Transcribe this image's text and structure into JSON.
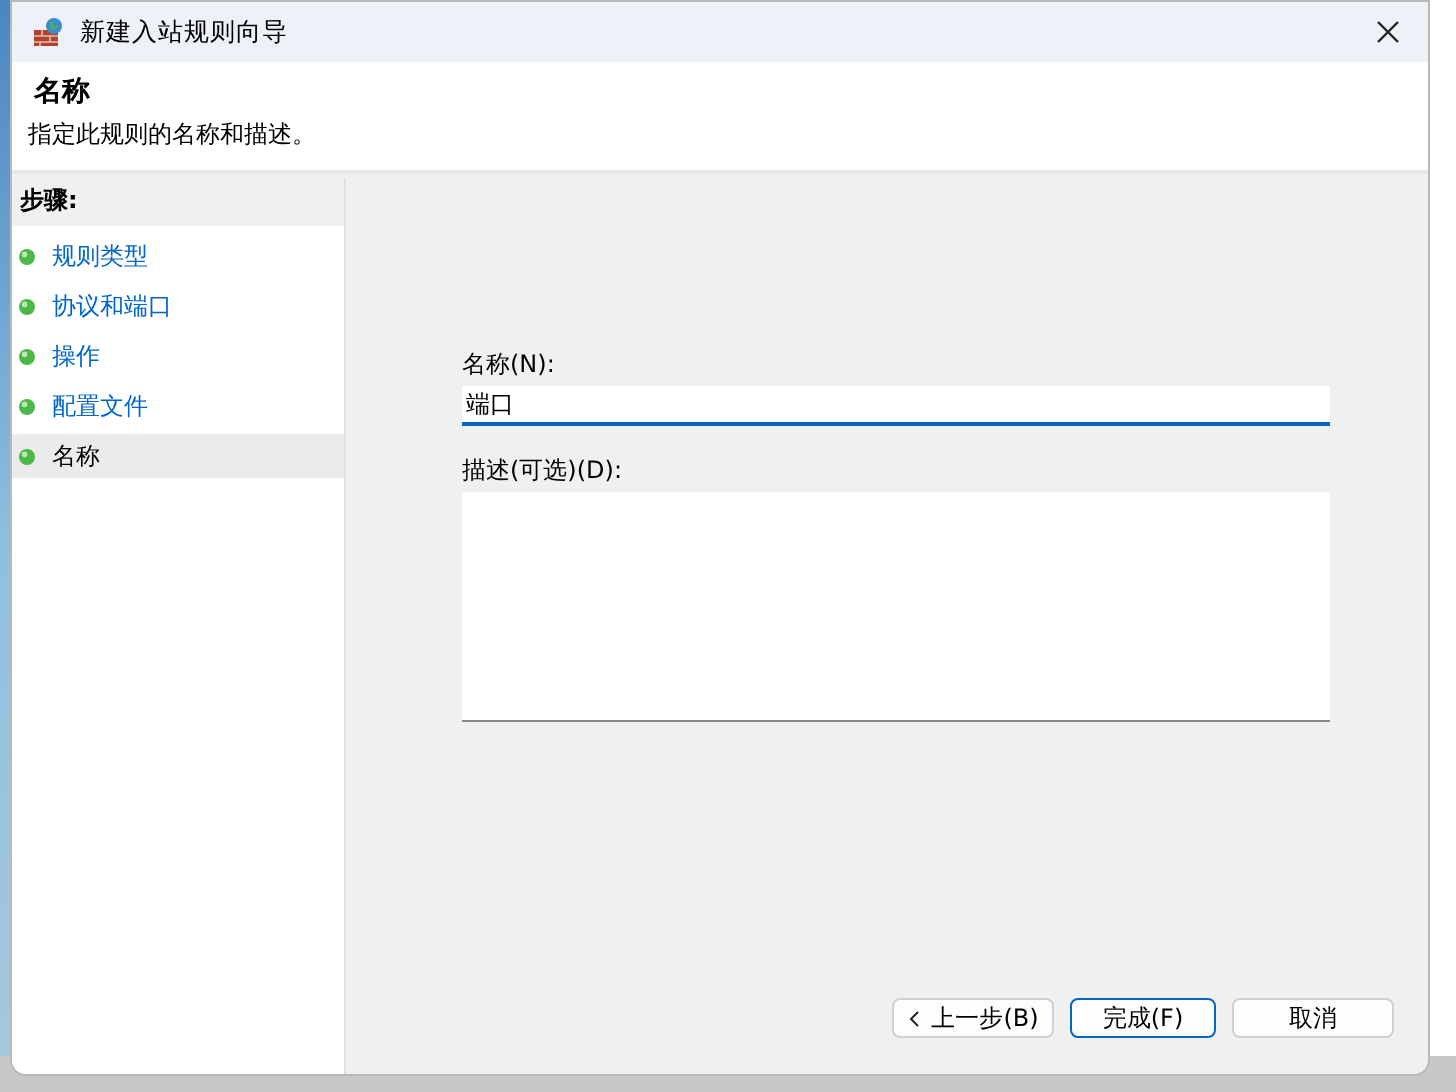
{
  "window": {
    "title": "新建入站规则向导"
  },
  "header": {
    "title": "名称",
    "description": "指定此规则的名称和描述。"
  },
  "steps": {
    "heading": "步骤:",
    "items": [
      {
        "label": "规则类型",
        "selected": false
      },
      {
        "label": "协议和端口",
        "selected": false
      },
      {
        "label": "操作",
        "selected": false
      },
      {
        "label": "配置文件",
        "selected": false
      },
      {
        "label": "名称",
        "selected": true
      }
    ]
  },
  "form": {
    "name": {
      "label": "名称(N):",
      "value": "端口"
    },
    "description": {
      "label": "描述(可选)(D):"
    }
  },
  "buttons": [
    {
      "label": "上一步(B)",
      "kind": "back",
      "default": false
    },
    {
      "label": "完成(F)",
      "kind": "plain",
      "default": true
    },
    {
      "label": "取消",
      "kind": "plain",
      "default": false
    }
  ]
}
